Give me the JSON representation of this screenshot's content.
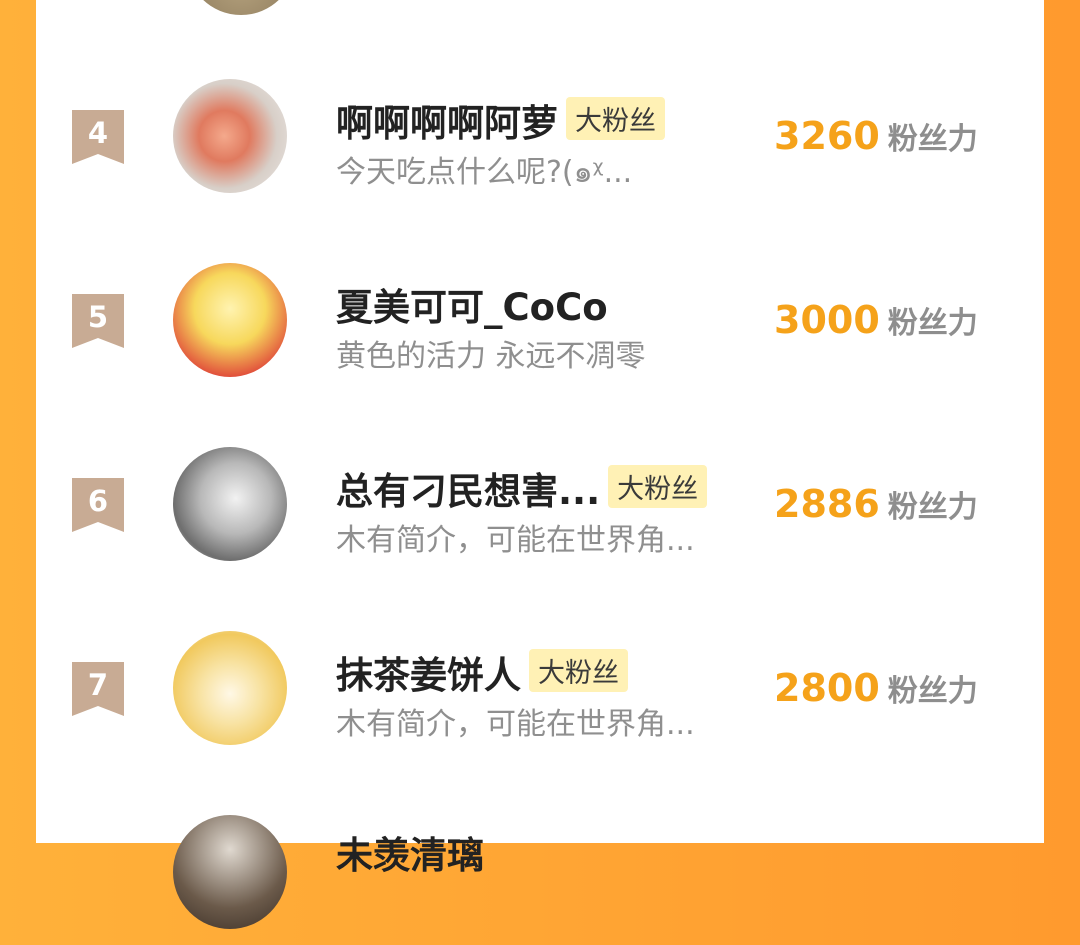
{
  "unit_label": "粉丝力",
  "badge_label": "大粉丝",
  "rows": [
    {
      "rank": "4",
      "name": "啊啊啊啊阿萝",
      "badge": "大粉丝",
      "bio": "今天吃点什么呢?(๑ᵡ...",
      "score": "3260"
    },
    {
      "rank": "5",
      "name": "夏美可可_CoCo",
      "badge": "",
      "bio": "黄色的活力 永远不凋零",
      "score": "3000"
    },
    {
      "rank": "6",
      "name": "总有刁民想害...",
      "badge": "大粉丝",
      "bio": "木有简介，可能在世界角...",
      "score": "2886"
    },
    {
      "rank": "7",
      "name": "抹茶姜饼人",
      "badge": "大粉丝",
      "bio": "木有简介，可能在世界角...",
      "score": "2800"
    },
    {
      "rank": "",
      "name": "未羡清璃",
      "badge": "",
      "bio": "",
      "score": ""
    }
  ],
  "colors": {
    "accent": "#f5a21a",
    "rank_bg": "#c8ab94",
    "frame": "#ffa533",
    "badge_bg": "#fff1b5"
  }
}
